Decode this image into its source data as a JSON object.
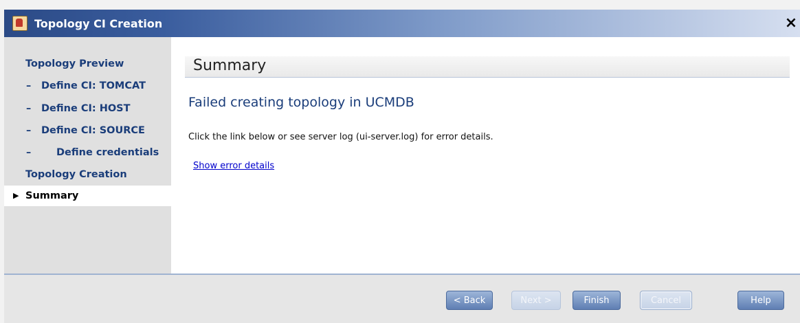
{
  "window": {
    "title": "Topology CI Creation",
    "close_glyph": "×"
  },
  "sidebar": {
    "items": [
      {
        "label": "Topology Preview"
      },
      {
        "dash": "–",
        "label": "Define CI: TOMCAT"
      },
      {
        "dash": "–",
        "label": "Define CI: HOST"
      },
      {
        "dash": "–",
        "label": "Define CI: SOURCE"
      },
      {
        "dash": "–",
        "label": "Define credentials"
      },
      {
        "label": "Topology Creation"
      },
      {
        "label": "Summary",
        "marker": "▶"
      }
    ]
  },
  "main": {
    "section_title": "Summary",
    "error_title": "Failed creating topology in UCMDB",
    "message": "Click the link below or see server log (ui-server.log) for error details.",
    "link_text": "Show error details"
  },
  "footer": {
    "back_label": "< Back",
    "next_label": "Next >",
    "finish_label": "Finish",
    "cancel_label": "Cancel",
    "help_label": "Help"
  },
  "colors": {
    "titlebar_start": "#2b4a86",
    "nav_text": "#1a3d7a",
    "link": "#0000cc",
    "button": "#6f8fc2"
  },
  "icons": {
    "app": "java-app-icon",
    "close": "close-icon",
    "current_step": "triangle-right-icon"
  }
}
